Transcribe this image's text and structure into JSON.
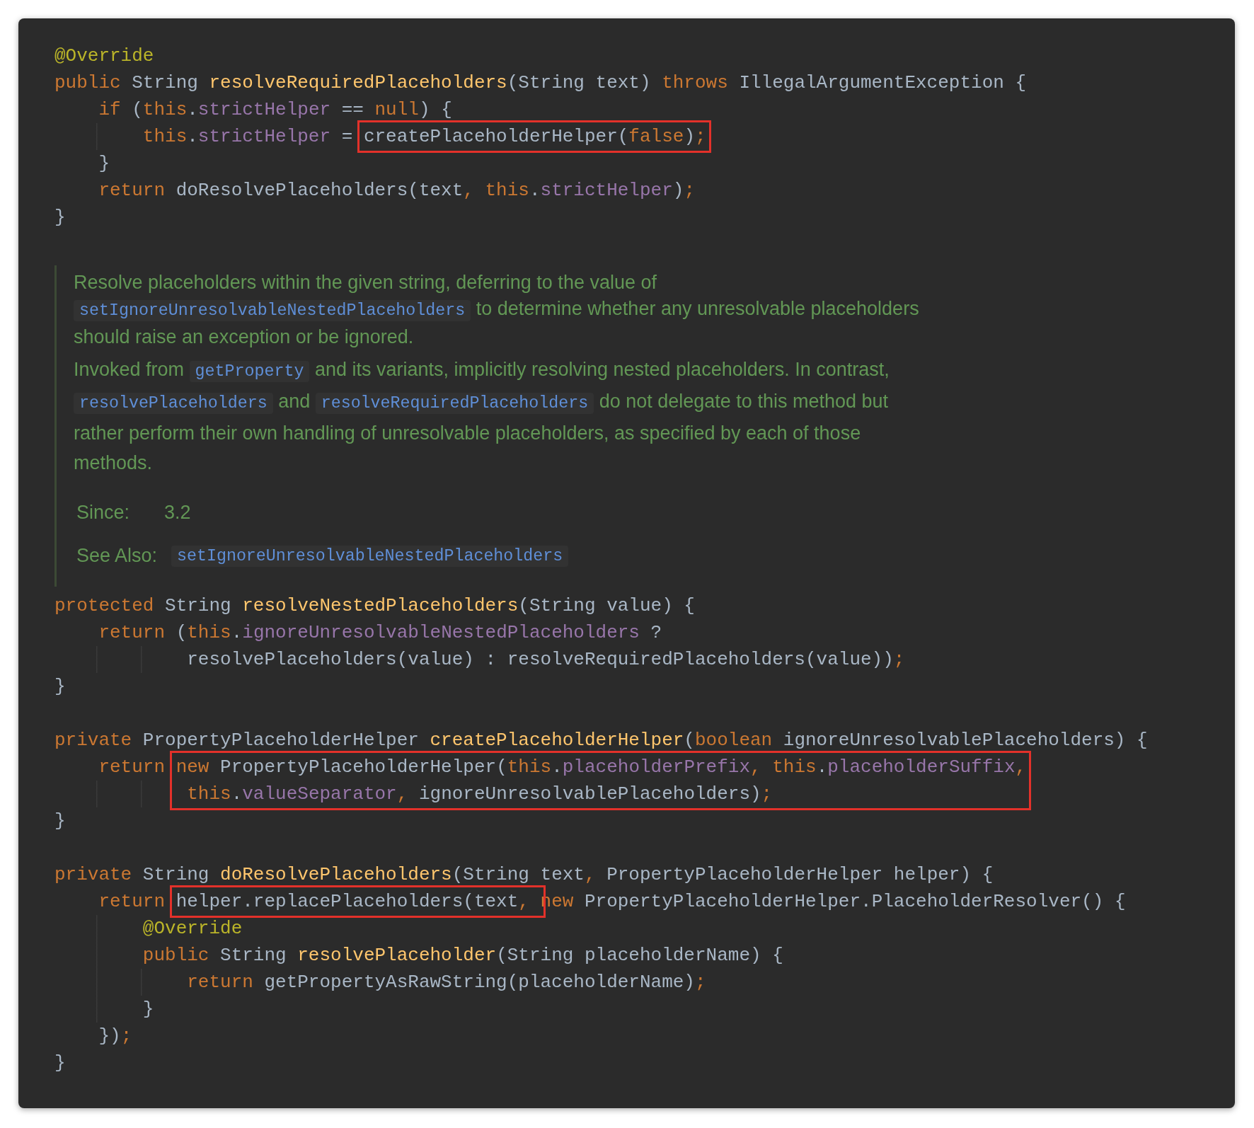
{
  "blocks": [
    {
      "kind": "code",
      "lines": [
        {
          "segments": [
            {
              "boxed": false,
              "tokens": [
                {
                  "kind": "annotation",
                  "text": "@Override"
                }
              ]
            }
          ]
        },
        {
          "segments": [
            {
              "boxed": false,
              "tokens": [
                {
                  "kind": "keyword",
                  "text": "public "
                },
                {
                  "kind": "plain",
                  "text": "String "
                },
                {
                  "kind": "declaration",
                  "text": "resolveRequiredPlaceholders"
                },
                {
                  "kind": "plain",
                  "text": "(String text) "
                },
                {
                  "kind": "keyword",
                  "text": "throws "
                },
                {
                  "kind": "plain",
                  "text": "IllegalArgumentException {"
                }
              ]
            }
          ]
        },
        {
          "segments": [
            {
              "boxed": false,
              "tokens": [
                {
                  "kind": "keyword",
                  "text": "    if "
                },
                {
                  "kind": "plain",
                  "text": "("
                },
                {
                  "kind": "keyword",
                  "text": "this"
                },
                {
                  "kind": "plain",
                  "text": "."
                },
                {
                  "kind": "field",
                  "text": "strictHelper"
                },
                {
                  "kind": "plain",
                  "text": " == "
                },
                {
                  "kind": "keyword",
                  "text": "null"
                },
                {
                  "kind": "plain",
                  "text": ") {"
                }
              ]
            }
          ]
        },
        {
          "segments": [
            {
              "boxed": false,
              "tokens": [
                {
                  "kind": "keyword",
                  "text": "        this"
                },
                {
                  "kind": "plain",
                  "text": "."
                },
                {
                  "kind": "field",
                  "text": "strictHelper"
                },
                {
                  "kind": "plain",
                  "text": " = "
                }
              ]
            },
            {
              "boxed": true,
              "tokens": [
                {
                  "kind": "plain",
                  "text": "createPlaceholderHelper("
                },
                {
                  "kind": "keyword",
                  "text": "false"
                },
                {
                  "kind": "plain",
                  "text": ")"
                },
                {
                  "kind": "keyword",
                  "text": ";"
                }
              ]
            }
          ]
        },
        {
          "segments": [
            {
              "boxed": false,
              "tokens": [
                {
                  "kind": "plain",
                  "text": "    }"
                }
              ]
            }
          ]
        },
        {
          "segments": [
            {
              "boxed": false,
              "tokens": [
                {
                  "kind": "keyword",
                  "text": "    return "
                },
                {
                  "kind": "plain",
                  "text": "doResolvePlaceholders(text"
                },
                {
                  "kind": "keyword",
                  "text": ", this"
                },
                {
                  "kind": "plain",
                  "text": "."
                },
                {
                  "kind": "field",
                  "text": "strictHelper"
                },
                {
                  "kind": "plain",
                  "text": ")"
                },
                {
                  "kind": "keyword",
                  "text": ";"
                }
              ]
            }
          ]
        },
        {
          "segments": [
            {
              "boxed": false,
              "tokens": [
                {
                  "kind": "plain",
                  "text": "}"
                }
              ]
            }
          ]
        }
      ]
    },
    {
      "kind": "doc",
      "paragraphs": [
        {
          "segments": [
            {
              "kind": "text",
              "text": "Resolve placeholders within the given string, deferring to the value of "
            },
            {
              "kind": "code",
              "text": "setIgnoreUnresolvableNestedPlaceholders"
            },
            {
              "kind": "text",
              "text": " to determine whether any unresolvable placeholders should raise an exception or be ignored."
            }
          ]
        },
        {
          "segments": [
            {
              "kind": "text",
              "text": "Invoked from "
            },
            {
              "kind": "code",
              "text": "getProperty"
            },
            {
              "kind": "text",
              "text": " and its variants, implicitly resolving nested placeholders. In contrast, "
            },
            {
              "kind": "code",
              "text": "resolvePlaceholders"
            },
            {
              "kind": "text",
              "text": " and "
            },
            {
              "kind": "code",
              "text": "resolveRequiredPlaceholders"
            },
            {
              "kind": "text",
              "text": " do not delegate to this method but rather perform their own handling of unresolvable placeholders, as specified by each of those methods."
            }
          ]
        }
      ],
      "since": {
        "label": "Since:",
        "value": "3.2"
      },
      "see_also": {
        "label": "See Also:",
        "value": "setIgnoreUnresolvableNestedPlaceholders"
      }
    },
    {
      "kind": "code",
      "lines": [
        {
          "segments": [
            {
              "boxed": false,
              "tokens": [
                {
                  "kind": "keyword",
                  "text": "protected "
                },
                {
                  "kind": "plain",
                  "text": "String "
                },
                {
                  "kind": "declaration",
                  "text": "resolveNestedPlaceholders"
                },
                {
                  "kind": "plain",
                  "text": "(String value) {"
                }
              ]
            }
          ]
        },
        {
          "segments": [
            {
              "boxed": false,
              "tokens": [
                {
                  "kind": "keyword",
                  "text": "    return "
                },
                {
                  "kind": "plain",
                  "text": "("
                },
                {
                  "kind": "keyword",
                  "text": "this"
                },
                {
                  "kind": "plain",
                  "text": "."
                },
                {
                  "kind": "field",
                  "text": "ignoreUnresolvableNestedPlaceholders"
                },
                {
                  "kind": "plain",
                  "text": " ?"
                }
              ]
            }
          ]
        },
        {
          "segments": [
            {
              "boxed": false,
              "tokens": [
                {
                  "kind": "plain",
                  "text": "            resolvePlaceholders(value) : resolveRequiredPlaceholders(value))"
                },
                {
                  "kind": "keyword",
                  "text": ";"
                }
              ]
            }
          ]
        },
        {
          "segments": [
            {
              "boxed": false,
              "tokens": [
                {
                  "kind": "plain",
                  "text": "}"
                }
              ]
            }
          ]
        }
      ]
    },
    {
      "kind": "code",
      "lines": [
        {
          "segments": [
            {
              "boxed": false,
              "tokens": [
                {
                  "kind": "keyword",
                  "text": "private "
                },
                {
                  "kind": "plain",
                  "text": "PropertyPlaceholderHelper "
                },
                {
                  "kind": "declaration",
                  "text": "createPlaceholderHelper"
                },
                {
                  "kind": "plain",
                  "text": "("
                },
                {
                  "kind": "keyword",
                  "text": "boolean "
                },
                {
                  "kind": "plain",
                  "text": "ignoreUnresolvablePlaceholders) {"
                }
              ]
            }
          ]
        },
        {
          "segments": [
            {
              "boxed": false,
              "tokens": [
                {
                  "kind": "keyword",
                  "text": "    return "
                }
              ]
            },
            {
              "boxed": true,
              "tokens": [
                {
                  "kind": "keyword",
                  "text": "new "
                },
                {
                  "kind": "plain",
                  "text": "PropertyPlaceholderHelper("
                },
                {
                  "kind": "keyword",
                  "text": "this"
                },
                {
                  "kind": "plain",
                  "text": "."
                },
                {
                  "kind": "field",
                  "text": "placeholderPrefix"
                },
                {
                  "kind": "keyword",
                  "text": ", this"
                },
                {
                  "kind": "plain",
                  "text": "."
                },
                {
                  "kind": "field",
                  "text": "placeholderSuffix"
                },
                {
                  "kind": "keyword",
                  "text": ","
                }
              ]
            }
          ]
        },
        {
          "segments": [
            {
              "boxed": true,
              "tokens": [
                {
                  "kind": "keyword",
                  "text": "            this"
                },
                {
                  "kind": "plain",
                  "text": "."
                },
                {
                  "kind": "field",
                  "text": "valueSeparator"
                },
                {
                  "kind": "keyword",
                  "text": ", "
                },
                {
                  "kind": "plain",
                  "text": "ignoreUnresolvablePlaceholders)"
                },
                {
                  "kind": "keyword",
                  "text": ";"
                }
              ]
            }
          ]
        },
        {
          "segments": [
            {
              "boxed": false,
              "tokens": [
                {
                  "kind": "plain",
                  "text": "}"
                }
              ]
            }
          ]
        }
      ]
    },
    {
      "kind": "code",
      "lines": [
        {
          "segments": [
            {
              "boxed": false,
              "tokens": [
                {
                  "kind": "keyword",
                  "text": "private "
                },
                {
                  "kind": "plain",
                  "text": "String "
                },
                {
                  "kind": "declaration",
                  "text": "doResolvePlaceholders"
                },
                {
                  "kind": "plain",
                  "text": "(String text"
                },
                {
                  "kind": "keyword",
                  "text": ", "
                },
                {
                  "kind": "plain",
                  "text": "PropertyPlaceholderHelper helper) {"
                }
              ]
            }
          ]
        },
        {
          "segments": [
            {
              "boxed": false,
              "tokens": [
                {
                  "kind": "keyword",
                  "text": "    return "
                }
              ]
            },
            {
              "boxed": true,
              "tokens": [
                {
                  "kind": "plain",
                  "text": "helper.replacePlaceholders(text"
                },
                {
                  "kind": "keyword",
                  "text": ", "
                }
              ]
            },
            {
              "boxed": false,
              "tokens": [
                {
                  "kind": "keyword",
                  "text": "new "
                },
                {
                  "kind": "plain",
                  "text": "PropertyPlaceholderHelper.PlaceholderResolver() {"
                }
              ]
            }
          ]
        },
        {
          "segments": [
            {
              "boxed": false,
              "tokens": [
                {
                  "kind": "annotation",
                  "text": "        @Override"
                }
              ]
            }
          ]
        },
        {
          "segments": [
            {
              "boxed": false,
              "tokens": [
                {
                  "kind": "keyword",
                  "text": "        public "
                },
                {
                  "kind": "plain",
                  "text": "String "
                },
                {
                  "kind": "declaration",
                  "text": "resolvePlaceholder"
                },
                {
                  "kind": "plain",
                  "text": "(String placeholderName) {"
                }
              ]
            }
          ]
        },
        {
          "segments": [
            {
              "boxed": false,
              "tokens": [
                {
                  "kind": "keyword",
                  "text": "            return "
                },
                {
                  "kind": "plain",
                  "text": "getPropertyAsRawString(placeholderName)"
                },
                {
                  "kind": "keyword",
                  "text": ";"
                }
              ]
            }
          ]
        },
        {
          "segments": [
            {
              "boxed": false,
              "tokens": [
                {
                  "kind": "plain",
                  "text": "        }"
                }
              ]
            }
          ]
        },
        {
          "segments": [
            {
              "boxed": false,
              "tokens": [
                {
                  "kind": "plain",
                  "text": "    })"
                },
                {
                  "kind": "keyword",
                  "text": ";"
                }
              ]
            }
          ]
        },
        {
          "segments": [
            {
              "boxed": false,
              "tokens": [
                {
                  "kind": "plain",
                  "text": "}"
                }
              ]
            }
          ]
        }
      ]
    }
  ]
}
